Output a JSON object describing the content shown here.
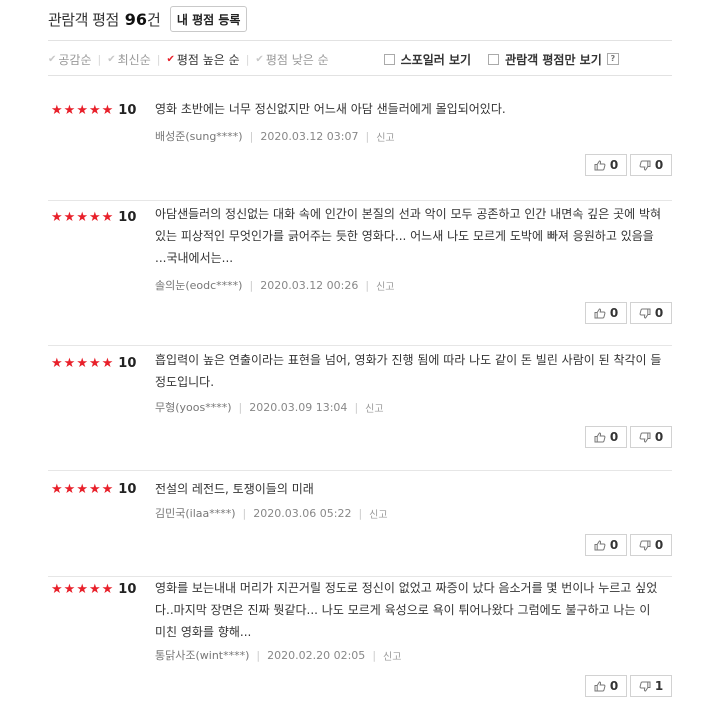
{
  "header": {
    "title": "관람객 평점",
    "count": "96",
    "unit": "건",
    "my_rating_button": "내 평점 등록"
  },
  "sort": {
    "options": [
      "공감순",
      "최신순",
      "평점 높은 순",
      "평점 낮은 순"
    ],
    "active_index": 2
  },
  "filters": {
    "spoiler_label": "스포일러 보기",
    "audience_only_label": "관람객 평점만 보기",
    "help_label": "?"
  },
  "colors": {
    "star": "#e8202a",
    "active_check": "#e8202a"
  },
  "reviews": [
    {
      "score": "10",
      "text": "영화 초반에는 너무 정신없지만 어느새 아담 샌들러에게 몰입되어있다.",
      "nickname": "배성준(sung****)",
      "date": "2020.03.12 03:07",
      "report": "신고",
      "likes": "0",
      "dislikes": "0"
    },
    {
      "score": "10",
      "text": "아담샌들러의 정신없는 대화 속에 인간이 본질의 선과 악이 모두 공존하고 인간 내면속 깊은 곳에 박혀 있는 피상적인 무엇인가를 긁어주는 듯한 영화다... 어느새 나도 모르게 도박에 빠져 응원하고 있음을 ...국내에서는...",
      "nickname": "솔의눈(eodc****)",
      "date": "2020.03.12 00:26",
      "report": "신고",
      "likes": "0",
      "dislikes": "0"
    },
    {
      "score": "10",
      "text": "흡입력이 높은 연출이라는 표현을 넘어, 영화가 진행 됨에 따라 나도 같이 돈 빌린 사람이 된 착각이 들 정도입니다.",
      "nickname": "무형(yoos****)",
      "date": "2020.03.09 13:04",
      "report": "신고",
      "likes": "0",
      "dislikes": "0"
    },
    {
      "score": "10",
      "text": "전설의 레전드, 토쟁이들의 미래",
      "nickname": "김민국(ilaa****)",
      "date": "2020.03.06 05:22",
      "report": "신고",
      "likes": "0",
      "dislikes": "0"
    },
    {
      "score": "10",
      "text": "영화를 보는내내 머리가 지끈거릴 정도로 정신이 없었고 짜증이 났다 음소거를 몇 번이나 누르고 싶었다..마지막 장면은 진짜 뭣같다... 나도 모르게 육성으로 욕이 튀어나왔다 그럼에도 불구하고 나는 이 미친 영화를 향해...",
      "nickname": "통닭사조(wint****)",
      "date": "2020.02.20 02:05",
      "report": "신고",
      "likes": "0",
      "dislikes": "1"
    }
  ]
}
